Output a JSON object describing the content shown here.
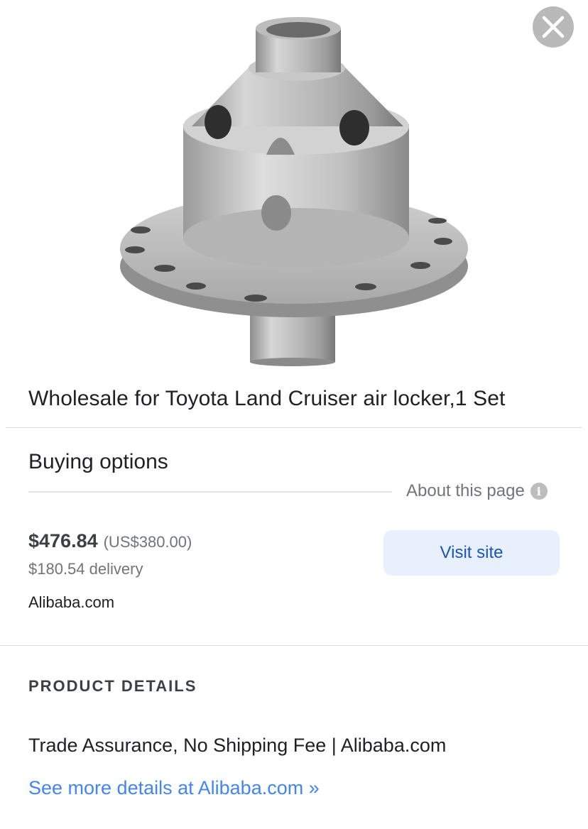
{
  "product": {
    "image_alt": "Air locker differential",
    "title": "Wholesale for Toyota Land Cruiser air locker,1 Set"
  },
  "buying_options": {
    "heading": "Buying options",
    "about_label": "About this page",
    "offer": {
      "price": "$476.84",
      "price_original": "(US$380.00)",
      "delivery": "$180.54 delivery",
      "seller": "Alibaba.com",
      "visit_label": "Visit site"
    }
  },
  "product_details": {
    "heading": "PRODUCT DETAILS",
    "description": "Trade Assurance, No Shipping Fee | Alibaba.com",
    "more_link": "See more details at Alibaba.com »"
  },
  "icons": {
    "close": "close-icon",
    "info": "info-icon"
  },
  "colors": {
    "link": "#4285f4",
    "button_bg": "#e8f0fe",
    "button_text": "#1a56b5"
  }
}
